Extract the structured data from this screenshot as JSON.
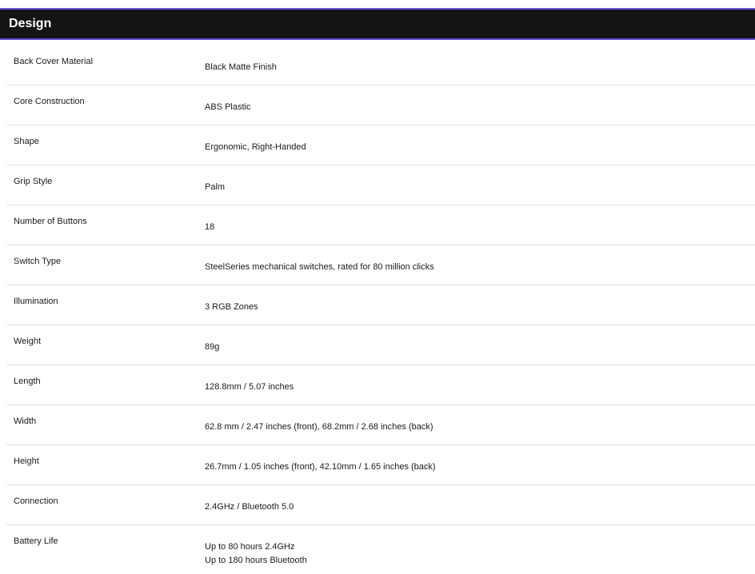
{
  "section": {
    "title": "Design"
  },
  "specs": [
    {
      "label": "Back Cover Material",
      "value": "Black Matte Finish"
    },
    {
      "label": "Core Construction",
      "value": "ABS Plastic"
    },
    {
      "label": "Shape",
      "value": "Ergonomic, Right-Handed"
    },
    {
      "label": "Grip Style",
      "value": "Palm"
    },
    {
      "label": "Number of Buttons",
      "value": "18"
    },
    {
      "label": "Switch Type",
      "value": "SteelSeries mechanical switches, rated for 80 million clicks"
    },
    {
      "label": "Illumination",
      "value": "3 RGB Zones"
    },
    {
      "label": "Weight",
      "value": "89g"
    },
    {
      "label": "Length",
      "value": "128.8mm / 5.07 inches"
    },
    {
      "label": "Width",
      "value": "62.8 mm / 2.47 inches (front), 68.2mm / 2.68 inches (back)"
    },
    {
      "label": "Height",
      "value": "26.7mm / 1.05 inches (front), 42.10mm / 1.65 inches (back)"
    },
    {
      "label": "Connection",
      "value": "2.4GHz / Bluetooth 5.0"
    },
    {
      "label": "Battery Life",
      "value_lines": [
        "Up to 80 hours 2.4GHz",
        "Up to 180 hours Bluetooth"
      ]
    }
  ]
}
